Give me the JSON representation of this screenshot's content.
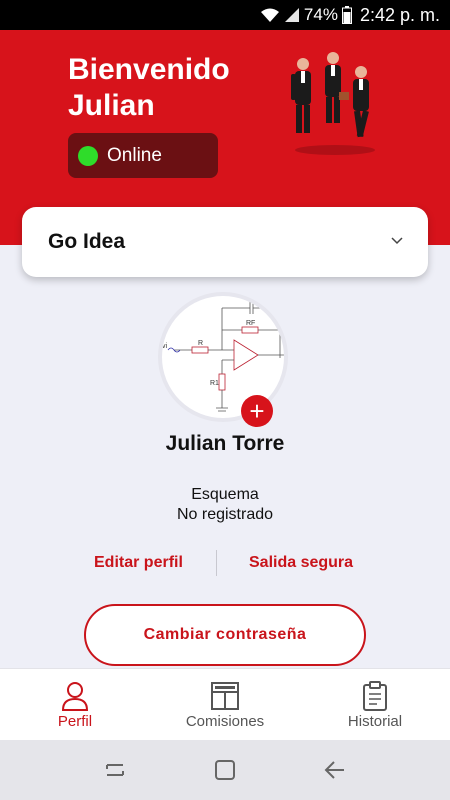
{
  "status_bar": {
    "battery": "74%",
    "time": "2:42 p. m."
  },
  "header": {
    "greeting_line1": "Bienvenido",
    "greeting_line2": "Julian",
    "status_label": "Online",
    "status_color": "#2fdc2a",
    "background_color": "#d7131b"
  },
  "dropdown": {
    "selected": "Go Idea",
    "icon": "chevron-down-icon"
  },
  "profile": {
    "name": "Julian Torre",
    "scheme_label": "Esquema",
    "scheme_value": "No registrado",
    "circuit_labels": {
      "input": "vi",
      "r": "R",
      "rf": "RF",
      "r1": "R1"
    }
  },
  "actions": {
    "edit_profile": "Editar perfil",
    "safe_exit": "Salida segura",
    "change_password": "Cambiar contraseña"
  },
  "bottom_nav": {
    "items": [
      {
        "label": "Perfil",
        "icon": "user-icon",
        "active": true
      },
      {
        "label": "Comisiones",
        "icon": "dashboard-icon",
        "active": false
      },
      {
        "label": "Historial",
        "icon": "clipboard-icon",
        "active": false
      }
    ]
  },
  "accent_color": "#c9141b"
}
